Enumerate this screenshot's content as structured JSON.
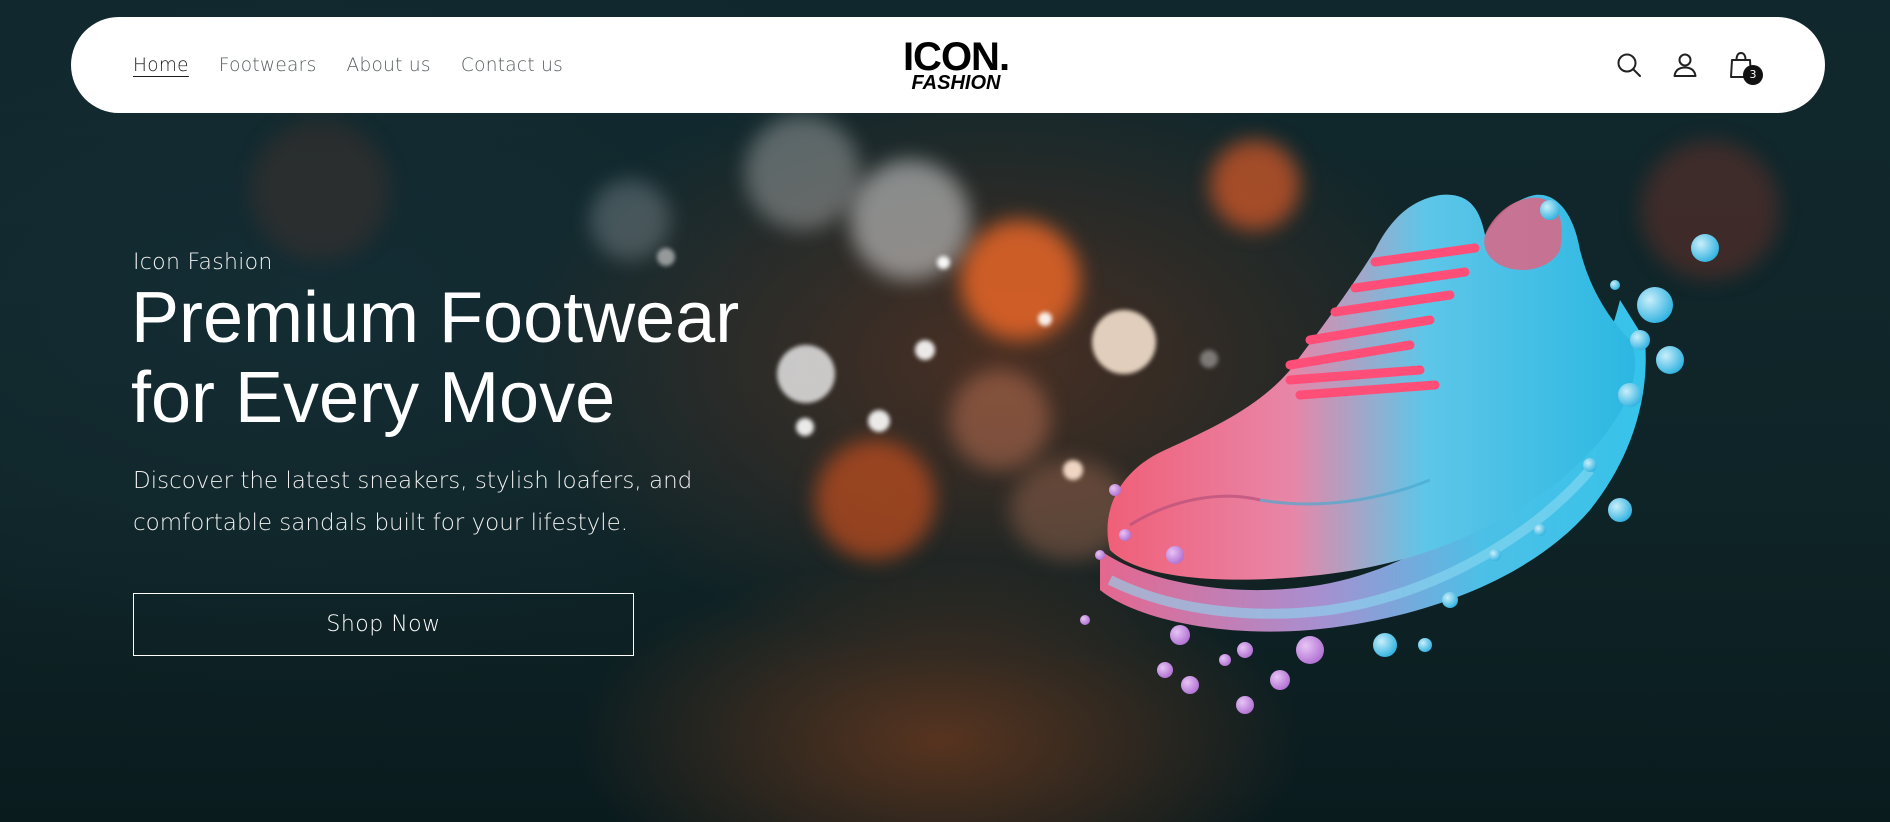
{
  "nav": {
    "items": [
      {
        "label": "Home",
        "active": true
      },
      {
        "label": "Footwears",
        "active": false
      },
      {
        "label": "About us",
        "active": false
      },
      {
        "label": "Contact us",
        "active": false
      }
    ]
  },
  "brand": {
    "line1": "ICON.",
    "line2": "FASHION"
  },
  "header_icons": {
    "search": "search-icon",
    "account": "user-icon",
    "cart": "shopping-bag-icon",
    "cart_count": "3"
  },
  "hero": {
    "eyebrow": "Icon Fashion",
    "headline_line1": "Premium Footwear",
    "headline_line2": "for Every Move",
    "subtext_line1": "Discover the latest sneakers, stylish loafers, and",
    "subtext_line2": "comfortable sandals built for your lifestyle.",
    "cta_label": "Shop Now"
  },
  "colors": {
    "header_bg": "#ffffff",
    "hero_bg": "#0f2427",
    "shoe_pink": "#f0627a",
    "shoe_cyan": "#35c4e6"
  }
}
